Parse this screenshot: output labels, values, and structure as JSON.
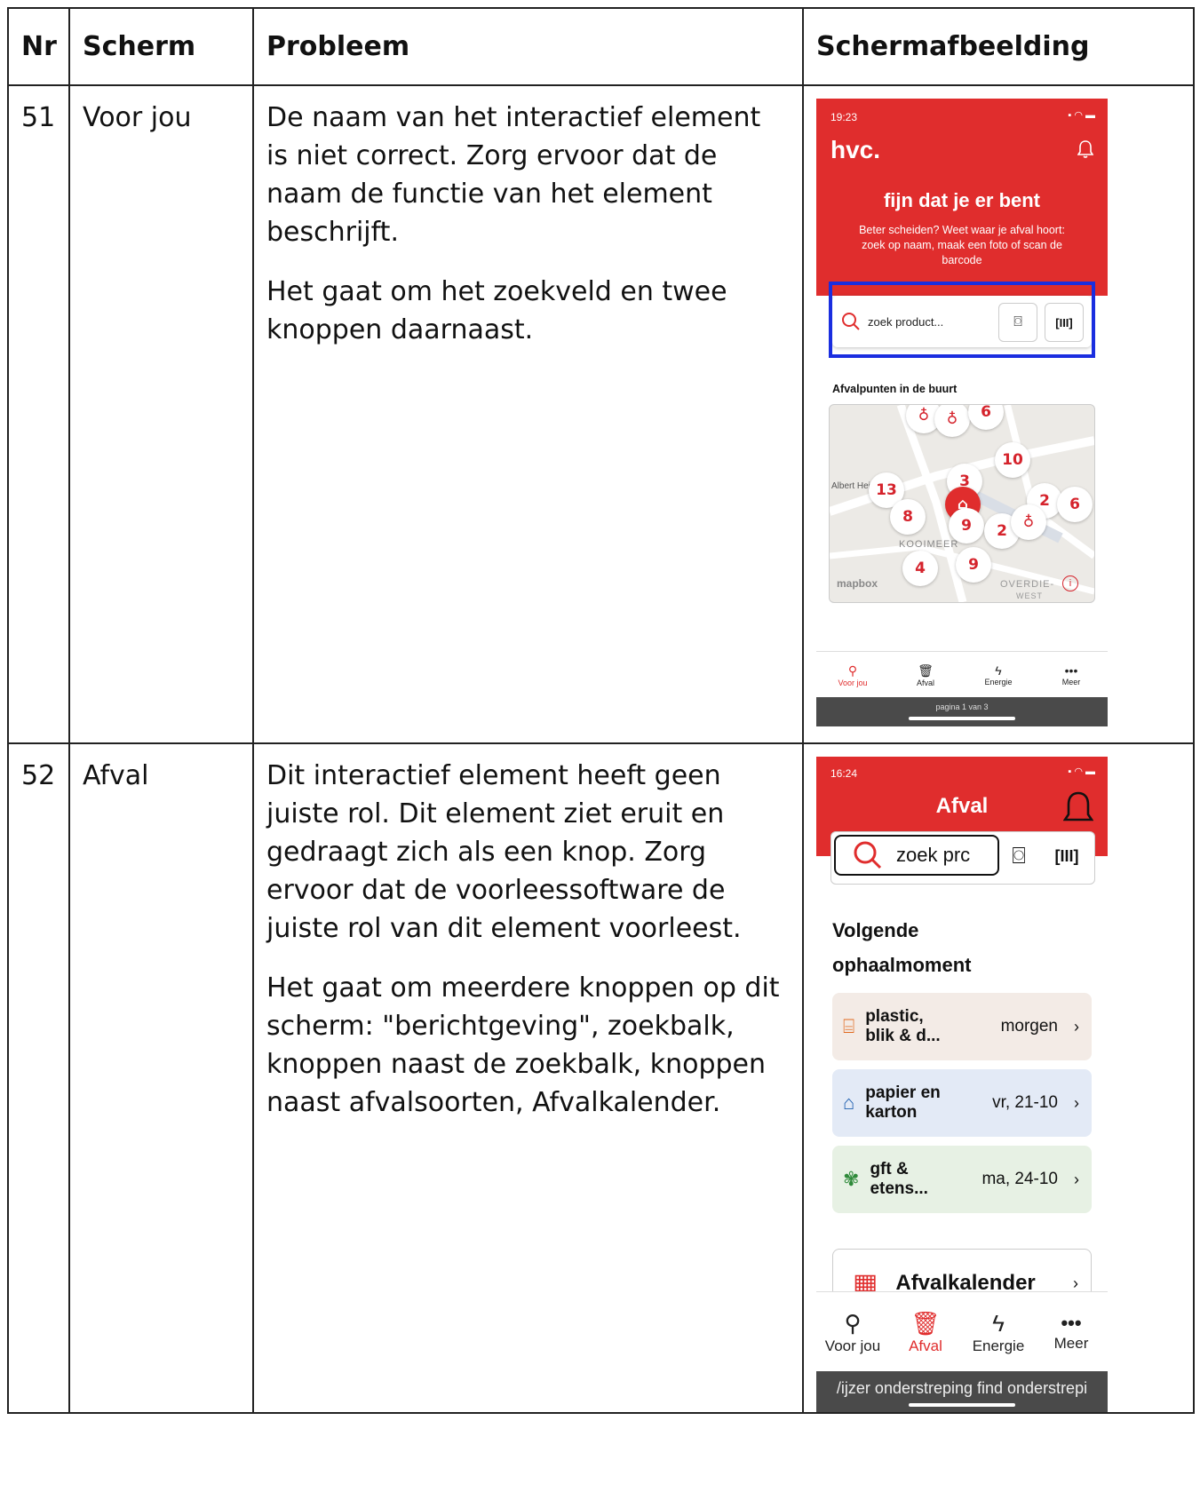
{
  "headers": {
    "nr": "Nr",
    "scherm": "Scherm",
    "probleem": "Probleem",
    "schermafbeelding": "Schermafbeelding"
  },
  "rows": [
    {
      "nr": "51",
      "scherm": "Voor jou",
      "p1": "De naam van het interactief element is niet correct. Zorg ervoor dat de naam de functie van het element beschrijft.",
      "p2": "Het gaat om het zoekveld en twee knoppen daarnaast."
    },
    {
      "nr": "52",
      "scherm": "Afval",
      "p1": "Dit interactief element heeft geen juiste rol. Dit element ziet eruit en gedraagt zich als een knop. Zorg ervoor dat de voorleessoftware de juiste rol van dit element voorleest.",
      "p2": "Het gaat om meerdere knoppen op dit scherm: \"berichtgeving\", zoekbalk, knoppen naast de zoekbalk, knoppen naast afvalsoorten, Afvalkalender."
    }
  ],
  "shot1": {
    "time": "19:23",
    "logo": "hvc.",
    "headline": "fijn dat je er bent",
    "sub": "Beter scheiden? Weet waar je afval hoort: zoek op naam, maak een foto of scan de barcode",
    "search_placeholder": "zoek product...",
    "section": "Afvalpunten in de buurt",
    "map_labels": {
      "store": "Albert Hei",
      "area": "KOOIMEER",
      "area2": "OVERDIE-",
      "area3": "WEST",
      "mapbox": "mapbox"
    },
    "pins": [
      "6",
      "10",
      "13",
      "3",
      "2",
      "6",
      "8",
      "9",
      "2",
      "4",
      "9"
    ],
    "tabs": [
      "Voor jou",
      "Afval",
      "Energie",
      "Meer"
    ],
    "page_indicator": "pagina 1 van 3"
  },
  "shot2": {
    "time": "16:24",
    "title": "Afval",
    "search_placeholder": "zoek prc",
    "section": "Volgende ophaalmoment",
    "items": [
      {
        "name": "plastic, blik & d...",
        "date": "morgen",
        "color": "#f3ebe6"
      },
      {
        "name": "papier en karton",
        "date": "vr, 21-10",
        "color": "#e3eaf6"
      },
      {
        "name": "gft & etens...",
        "date": "ma, 24-10",
        "color": "#e7f1e4"
      }
    ],
    "calendar": "Afvalkalender",
    "tabs": [
      "Voor jou",
      "Afval",
      "Energie",
      "Meer"
    ],
    "bottom_text": "/ijzer onderstreping find onderstrepi"
  },
  "colors": {
    "brand": "#e02d2d",
    "highlight": "#1a2ee0"
  }
}
